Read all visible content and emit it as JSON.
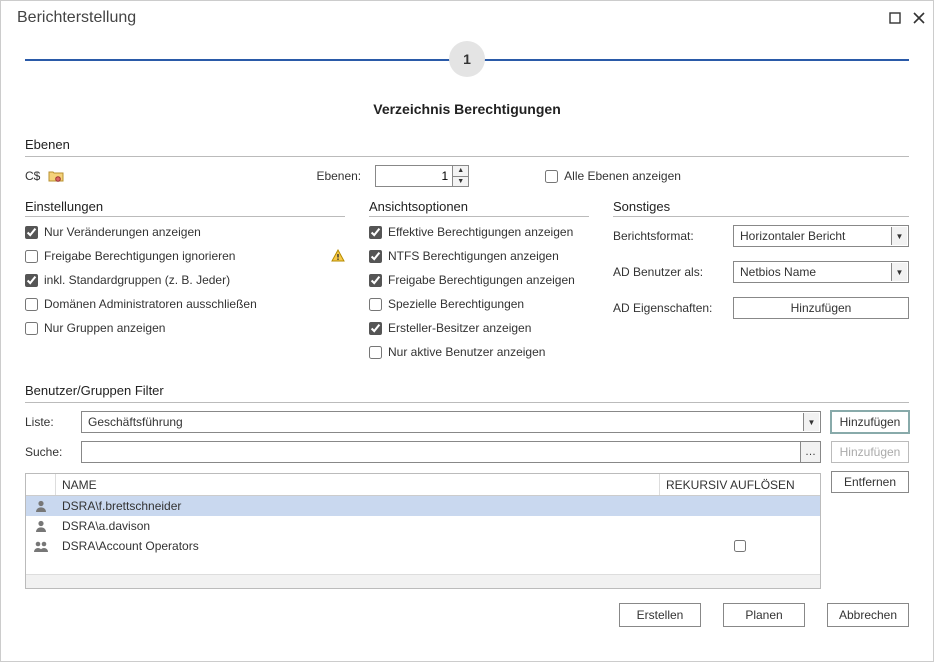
{
  "window": {
    "title": "Berichterstellung"
  },
  "stepper": {
    "number": "1"
  },
  "subtitle": "Verzeichnis Berechtigungen",
  "ebenen": {
    "section_label": "Ebenen",
    "share_name": "C$",
    "levels_label": "Ebenen:",
    "levels_value": "1",
    "show_all_checked": false,
    "show_all_label": "Alle Ebenen anzeigen"
  },
  "settings": {
    "title": "Einstellungen",
    "items": [
      {
        "label": "Nur Veränderungen anzeigen",
        "checked": true,
        "warn": false
      },
      {
        "label": "Freigabe Berechtigungen ignorieren",
        "checked": false,
        "warn": true
      },
      {
        "label": "inkl. Standardgruppen (z. B. Jeder)",
        "checked": true,
        "warn": false
      },
      {
        "label": "Domänen Administratoren ausschließen",
        "checked": false,
        "warn": false
      },
      {
        "label": "Nur Gruppen anzeigen",
        "checked": false,
        "warn": false
      }
    ]
  },
  "viewopts": {
    "title": "Ansichtsoptionen",
    "items": [
      {
        "label": "Effektive Berechtigungen anzeigen",
        "checked": true
      },
      {
        "label": "NTFS Berechtigungen anzeigen",
        "checked": true
      },
      {
        "label": "Freigabe Berechtigungen anzeigen",
        "checked": true
      },
      {
        "label": "Spezielle Berechtigungen",
        "checked": false
      },
      {
        "label": "Ersteller-Besitzer anzeigen",
        "checked": true
      },
      {
        "label": "Nur aktive Benutzer anzeigen",
        "checked": false
      }
    ]
  },
  "misc": {
    "title": "Sonstiges",
    "format_label": "Berichtsformat:",
    "format_value": "Horizontaler Bericht",
    "aduser_label": "AD Benutzer als:",
    "aduser_value": "Netbios Name",
    "adprops_label": "AD Eigenschaften:",
    "add_btn": "Hinzufügen"
  },
  "filter": {
    "section_label": "Benutzer/Gruppen Filter",
    "list_label": "Liste:",
    "list_value": "Geschäftsführung",
    "search_label": "Suche:",
    "search_value": "",
    "add_btn": "Hinzufügen",
    "remove_btn": "Entfernen",
    "columns": {
      "name": "NAME",
      "recursive": "REKURSIV AUFLÖSEN"
    },
    "rows": [
      {
        "type": "user",
        "name": "DSRA\\f.brettschneider",
        "recursive": null,
        "selected": true
      },
      {
        "type": "user",
        "name": "DSRA\\a.davison",
        "recursive": null,
        "selected": false
      },
      {
        "type": "group",
        "name": "DSRA\\Account Operators",
        "recursive": false,
        "selected": false
      }
    ]
  },
  "footer": {
    "create": "Erstellen",
    "schedule": "Planen",
    "cancel": "Abbrechen"
  }
}
